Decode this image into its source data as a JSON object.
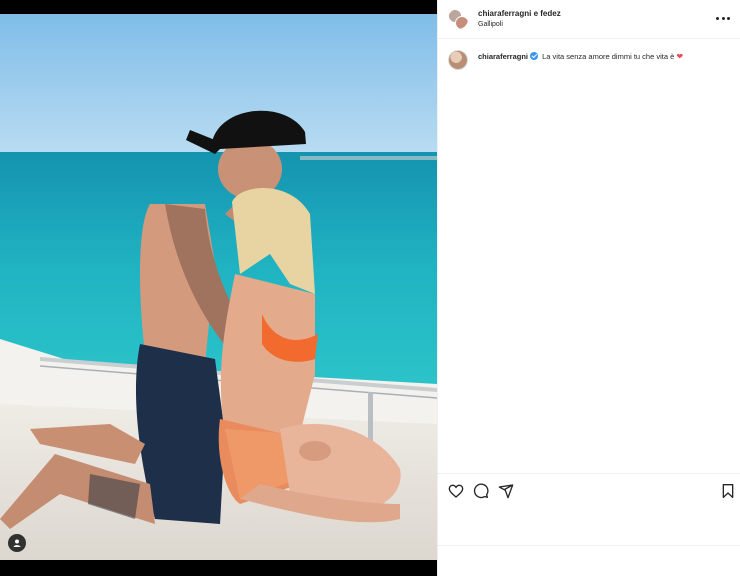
{
  "post": {
    "author": "chiaraferragni e fedez",
    "location": "Gallipoli"
  },
  "caption": {
    "username": "chiaraferragni",
    "text": "La vita senza amore dimmi tu che vita è",
    "emoji": "❤"
  },
  "icons": {
    "more": "more-options-icon",
    "like": "heart-icon",
    "comment": "comment-icon",
    "share": "share-icon",
    "save": "bookmark-icon",
    "tag": "user-tag-icon"
  },
  "colors": {
    "verified": "#3897f0",
    "heart": "#ed4956",
    "text": "#262626",
    "sea": "#2ec4c9",
    "sky": "#8fc8ec"
  }
}
